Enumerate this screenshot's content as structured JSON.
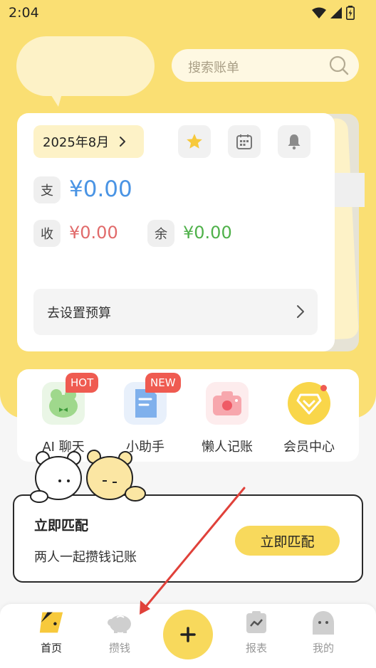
{
  "status_bar": {
    "time": "2:04"
  },
  "search": {
    "placeholder": "搜索账单"
  },
  "card": {
    "month": "2025年8月",
    "expense_label": "支",
    "expense_value": "¥0.00",
    "income_label": "收",
    "income_value": "¥0.00",
    "balance_label": "余",
    "balance_value": "¥0.00",
    "budget_text": "去设置预算"
  },
  "features": [
    {
      "label": "AI 聊天",
      "badge": "HOT",
      "icon": "frog-chat-icon"
    },
    {
      "label": "小助手",
      "badge": "NEW",
      "icon": "document-assistant-icon"
    },
    {
      "label": "懒人记账",
      "badge": "",
      "icon": "camera-icon"
    },
    {
      "label": "会员中心",
      "badge": "",
      "icon": "diamond-vip-icon"
    }
  ],
  "match": {
    "title": "立即匹配",
    "subtitle": "两人一起攒钱记账",
    "button": "立即匹配"
  },
  "nav": {
    "items": [
      {
        "label": "首页",
        "icon": "home-icon",
        "active": true
      },
      {
        "label": "攒钱",
        "icon": "piggy-bank-icon",
        "active": false
      },
      {
        "label": "",
        "icon": "plus-icon",
        "active": false
      },
      {
        "label": "报表",
        "icon": "report-icon",
        "active": false
      },
      {
        "label": "我的",
        "icon": "profile-icon",
        "active": false
      }
    ]
  },
  "colors": {
    "brand_yellow": "#fadf73",
    "expense_blue": "#4a94e4",
    "income_red": "#e16a6a",
    "balance_green": "#4fb14a",
    "badge_red": "#ef5b51",
    "annotation_arrow": "#e0413a"
  }
}
